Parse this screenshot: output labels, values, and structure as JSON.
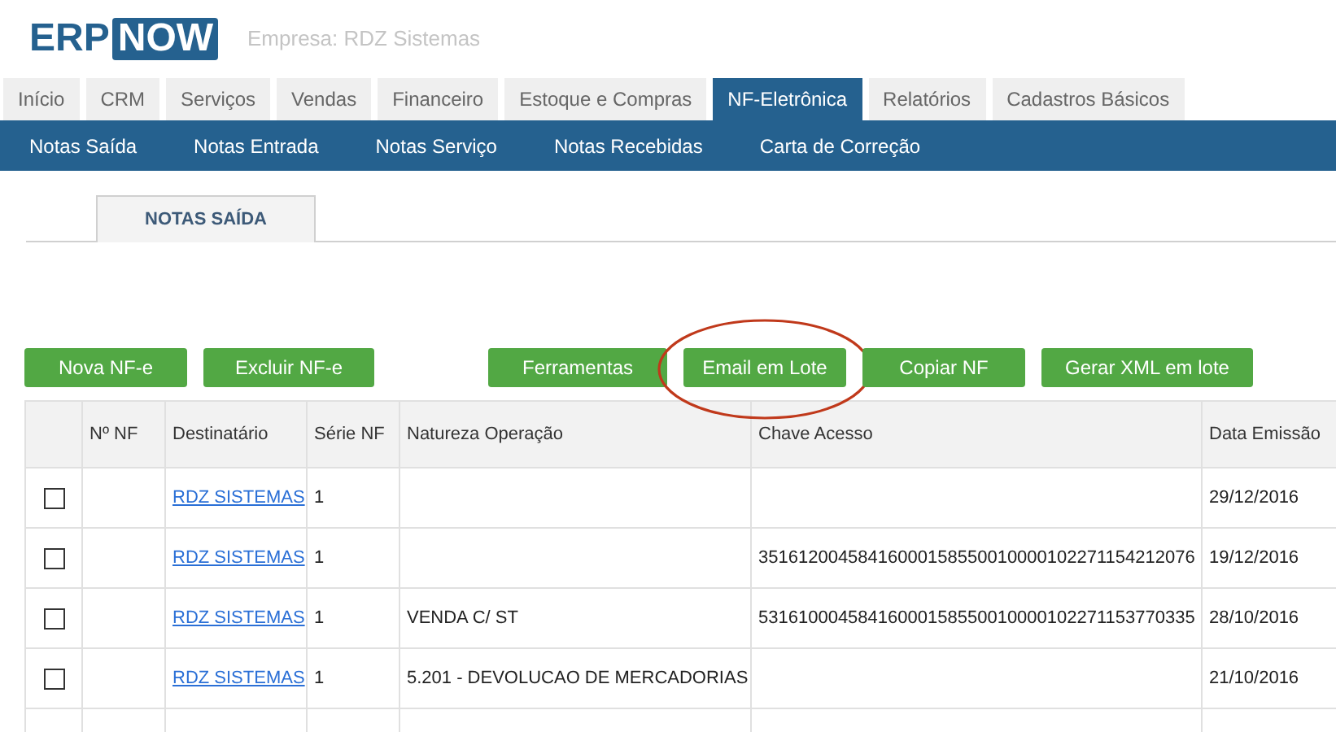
{
  "logo": {
    "part_1": "ERP",
    "part_2": "NOW"
  },
  "company": "Empresa: RDZ Sistemas",
  "main_tabs": [
    {
      "label": "Início",
      "selected": false
    },
    {
      "label": "CRM",
      "selected": false
    },
    {
      "label": "Serviços",
      "selected": false
    },
    {
      "label": "Vendas",
      "selected": false
    },
    {
      "label": "Financeiro",
      "selected": false
    },
    {
      "label": "Estoque e Compras",
      "selected": false
    },
    {
      "label": "NF-Eletrônica",
      "selected": true
    },
    {
      "label": "Relatórios",
      "selected": false
    },
    {
      "label": "Cadastros Básicos",
      "selected": false
    }
  ],
  "sub_menu": [
    "Notas Saída",
    "Notas Entrada",
    "Notas Serviço",
    "Notas Recebidas",
    "Carta de Correção"
  ],
  "page_tab": "NOTAS SAÍDA",
  "buttons": [
    {
      "label": "Nova NF-e",
      "highlighted": false
    },
    {
      "label": "Excluir NF-e",
      "highlighted": false
    },
    {
      "label": "Ferramentas",
      "highlighted": false
    },
    {
      "label": "Email em Lote",
      "highlighted": true
    },
    {
      "label": "Copiar NF",
      "highlighted": false
    },
    {
      "label": "Gerar XML em lote",
      "highlighted": false
    }
  ],
  "table": {
    "columns": [
      "Nº NF",
      "Destinatário",
      "Série NF",
      "Natureza Operação",
      "Chave Acesso",
      "Data Emissão"
    ],
    "rows": [
      {
        "checked": false,
        "destinatario": "RDZ SISTEMAS",
        "serie": "1",
        "natureza": "",
        "chave": "",
        "data": "29/12/2016"
      },
      {
        "checked": false,
        "destinatario": "RDZ SISTEMAS",
        "serie": "1",
        "natureza": "",
        "chave": "35161200458416000158550010000102271154212076",
        "data": "19/12/2016"
      },
      {
        "checked": false,
        "destinatario": "RDZ SISTEMAS",
        "serie": "1",
        "natureza": "VENDA C/ ST",
        "chave": "53161000458416000158550010000102271153770335",
        "data": "28/10/2016"
      },
      {
        "checked": false,
        "destinatario": "RDZ SISTEMAS",
        "serie": "1",
        "natureza": "5.201 - DEVOLUCAO DE MERCADORIAS",
        "chave": "",
        "data": "21/10/2016"
      }
    ]
  }
}
